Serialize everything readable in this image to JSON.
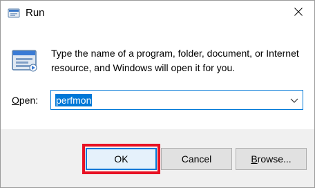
{
  "window": {
    "title": "Run",
    "close_icon": "close-icon",
    "app_icon": "run-app-icon"
  },
  "content": {
    "description": "Type the name of a program, folder, document, or Internet resource, and Windows will open it for you.",
    "open_label_mnemonic": "O",
    "open_label_rest": "pen:",
    "open_value": "perfmon",
    "dropdown_icon": "chevron-down-icon"
  },
  "buttons": {
    "ok_label": "OK",
    "cancel_label": "Cancel",
    "browse_mnemonic": "B",
    "browse_rest": "rowse..."
  },
  "colors": {
    "accent": "#0078d7",
    "highlight": "#e81123",
    "footer_bg": "#f0f0f0",
    "button_bg": "#e1e1e1"
  }
}
